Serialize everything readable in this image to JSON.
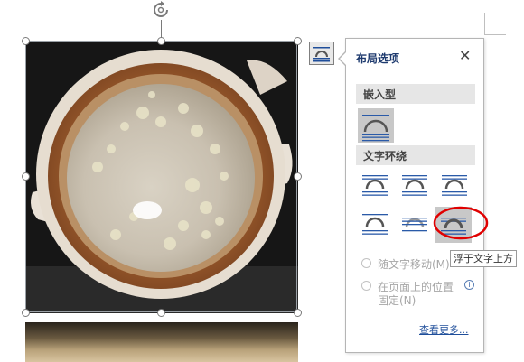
{
  "panel": {
    "title": "布局选项",
    "close_label": "✕",
    "section_inline": "嵌入型",
    "section_wrap": "文字环绕",
    "wrap_options_selected": "inline",
    "hovered_option": "in-front-of-text",
    "radio_move_with_text": "随文字移动(M)",
    "radio_fix_position_line1": "在页面上的位置",
    "radio_fix_position_line2": "固定(N)",
    "see_more": "查看更多..."
  },
  "tooltip": {
    "text": "浮于文字上方"
  },
  "icons": {
    "rotate": "rotate-icon",
    "layout_options": "layout-options-icon",
    "info": "info-icon"
  },
  "colors": {
    "accent_title": "#1e3a6e",
    "link": "#1f4e9a",
    "highlight_circle": "#e00000",
    "selected_bg": "#c8c8c8"
  }
}
